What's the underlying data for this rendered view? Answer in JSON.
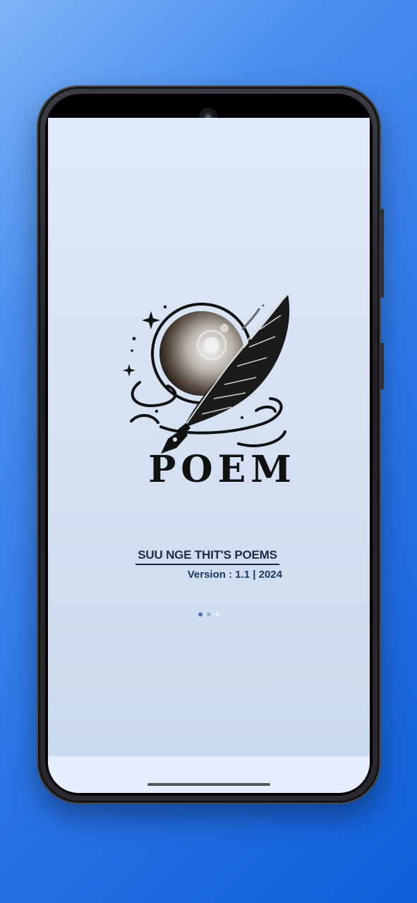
{
  "app": {
    "logo_text": "POEM",
    "title": "SUU NGE THIT'S POEMS",
    "version": "Version : 1.1 | 2024"
  },
  "loading": {
    "dot_count": 3,
    "active_index": 0
  },
  "colors": {
    "background_start": "#7fb4f6",
    "background_end": "#0f5fd9",
    "screen_background": "#dfeafa",
    "title_text": "#1f2a44",
    "version_text": "#1e3566",
    "dot_active": "#4d6fb3",
    "dot_mid": "#9fb3d6",
    "dot_inactive": "#e8eef7"
  },
  "icons": {
    "logo": "quill-pen-moon-logo",
    "camera": "front-camera-icon"
  }
}
